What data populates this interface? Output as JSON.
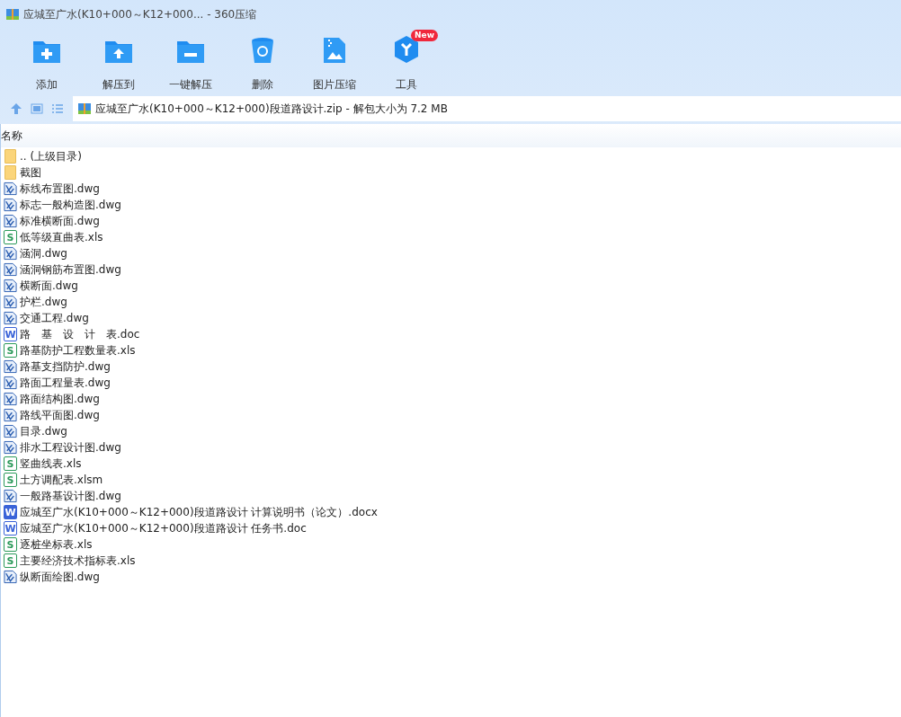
{
  "window": {
    "title": "应城至广水(K10+000～K12+000... - 360压缩"
  },
  "toolbar": [
    {
      "kind": "add",
      "label": "添加"
    },
    {
      "kind": "extract",
      "label": "解压到"
    },
    {
      "kind": "oneclick",
      "label": "一键解压"
    },
    {
      "kind": "delete",
      "label": "删除"
    },
    {
      "kind": "image",
      "label": "图片压缩"
    },
    {
      "kind": "tools",
      "label": "工具",
      "badge": "New"
    }
  ],
  "address": {
    "path": "应城至广水(K10+000～K12+000)段道路设计.zip - 解包大小为 7.2 MB"
  },
  "table": {
    "columns": [
      "名称"
    ],
    "rows": [
      {
        "kind": "folder",
        "name": ".. (上级目录)"
      },
      {
        "kind": "folder",
        "name": "截图"
      },
      {
        "kind": "dwg",
        "name": "标线布置图.dwg"
      },
      {
        "kind": "dwg",
        "name": "标志一般构造图.dwg"
      },
      {
        "kind": "dwg",
        "name": "标准横断面.dwg"
      },
      {
        "kind": "xls",
        "icon_text": "S",
        "name": "低等级直曲表.xls"
      },
      {
        "kind": "dwg",
        "name": "涵洞.dwg"
      },
      {
        "kind": "dwg",
        "name": "涵洞钢筋布置图.dwg"
      },
      {
        "kind": "dwg",
        "name": "横断面.dwg"
      },
      {
        "kind": "dwg",
        "name": "护栏.dwg"
      },
      {
        "kind": "dwg",
        "name": "交通工程.dwg"
      },
      {
        "kind": "doc",
        "icon_text": "W",
        "name": "路　基　设　计　表.doc"
      },
      {
        "kind": "xls",
        "icon_text": "S",
        "name": "路基防护工程数量表.xls"
      },
      {
        "kind": "dwg",
        "name": "路基支挡防护.dwg"
      },
      {
        "kind": "dwg",
        "name": "路面工程量表.dwg"
      },
      {
        "kind": "dwg",
        "name": "路面结构图.dwg"
      },
      {
        "kind": "dwg",
        "name": "路线平面图.dwg"
      },
      {
        "kind": "dwg",
        "name": "目录.dwg"
      },
      {
        "kind": "dwg",
        "name": "排水工程设计图.dwg"
      },
      {
        "kind": "xls",
        "icon_text": "S",
        "name": "竖曲线表.xls"
      },
      {
        "kind": "xls",
        "icon_text": "S",
        "name": "土方调配表.xlsm"
      },
      {
        "kind": "dwg",
        "name": "一般路基设计图.dwg"
      },
      {
        "kind": "docx",
        "icon_text": "W",
        "name": "应城至广水(K10+000～K12+000)段道路设计 计算说明书（论文）.docx"
      },
      {
        "kind": "doc",
        "icon_text": "W",
        "name": "应城至广水(K10+000～K12+000)段道路设计 任务书.doc"
      },
      {
        "kind": "xls",
        "icon_text": "S",
        "name": "逐桩坐标表.xls"
      },
      {
        "kind": "xls",
        "icon_text": "S",
        "name": "主要经济技术指标表.xls"
      },
      {
        "kind": "dwg",
        "name": "纵断面绘图.dwg"
      }
    ]
  }
}
